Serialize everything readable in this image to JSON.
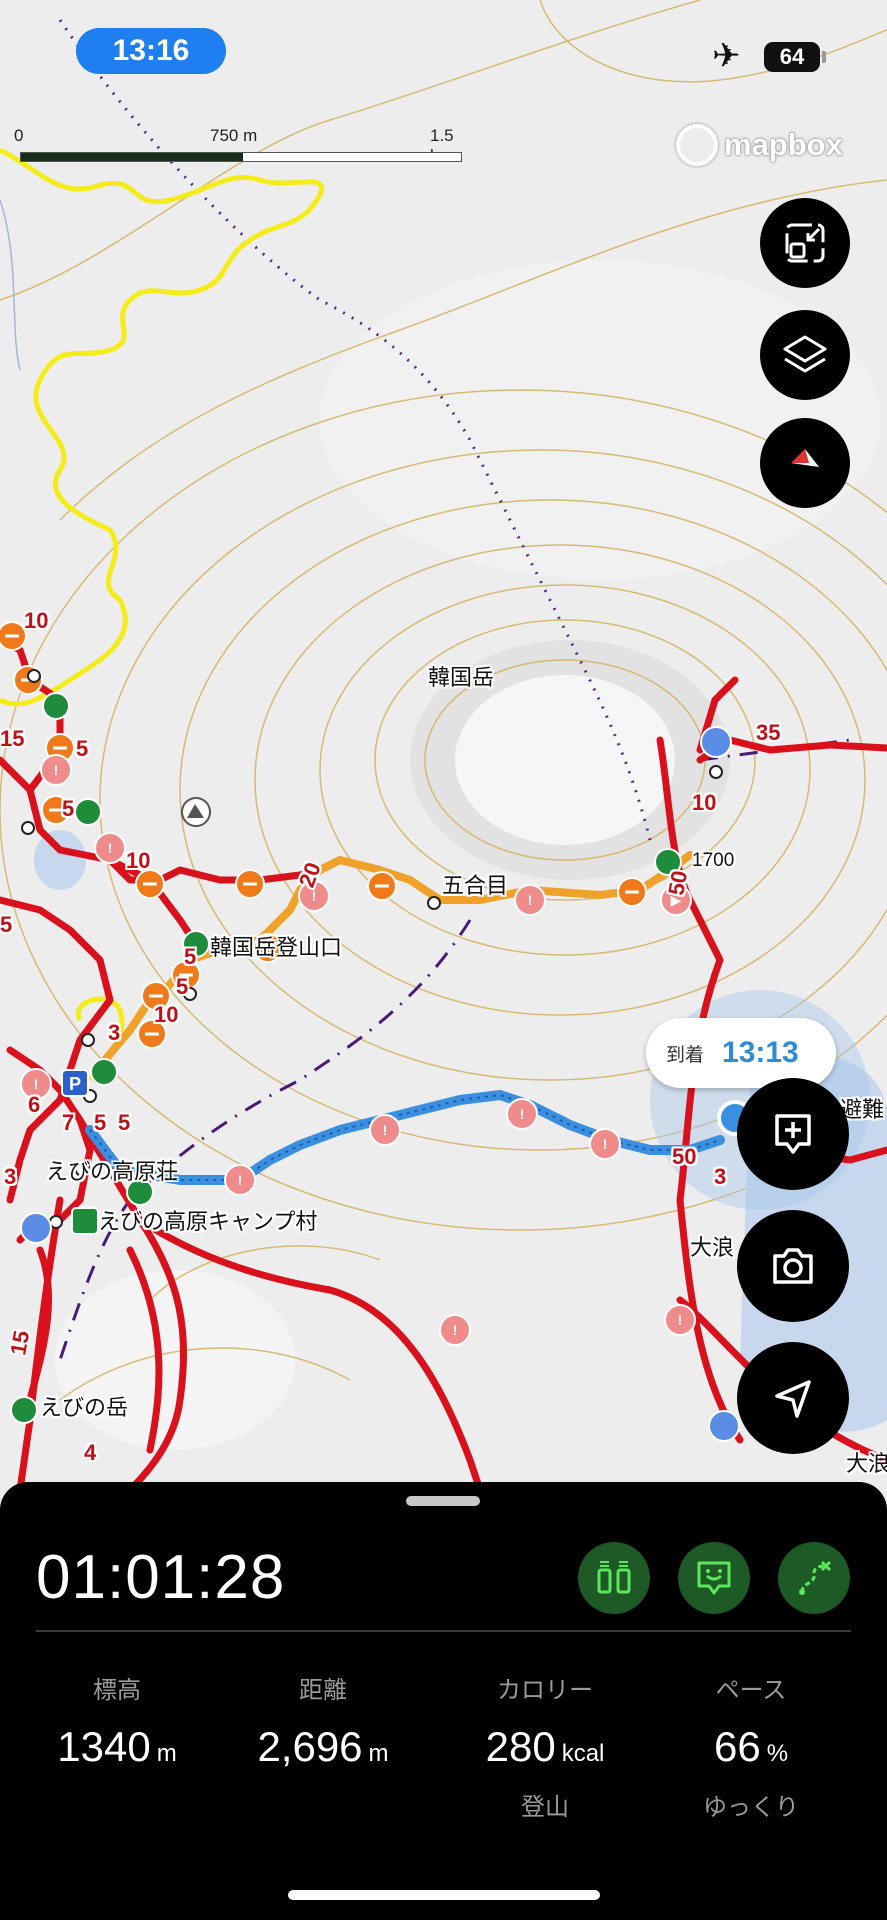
{
  "status_bar": {
    "time": "13:16",
    "battery": "64"
  },
  "scale_bar": {
    "labels": [
      "0",
      "750 m",
      "1.5 km"
    ]
  },
  "attribution": "mapbox",
  "map": {
    "labels": [
      "韓国岳",
      "五合目",
      "1700",
      "韓国岳登山口",
      "えびの高原荘",
      "えびの高原キャンプ村",
      "えびの岳",
      "避難",
      "大浪",
      "大浪"
    ],
    "route_numbers": [
      "10",
      "15",
      "5",
      "5",
      "10",
      "20",
      "5",
      "5",
      "10",
      "3",
      "6",
      "7",
      "5",
      "5",
      "3",
      "15",
      "4",
      "35",
      "10",
      "50",
      "50",
      "3",
      "5"
    ]
  },
  "eta": {
    "label": "到着",
    "time": "13:13"
  },
  "controls": {
    "zoom_fit": "zoom-fit",
    "layers": "layers",
    "compass": "compass",
    "add_note": "add-note",
    "camera": "camera",
    "locate": "locate"
  },
  "panel": {
    "timer": "01:01:28",
    "stats": [
      {
        "label": "標高",
        "value": "1340",
        "unit": "m",
        "sub": ""
      },
      {
        "label": "距離",
        "value": "2,696",
        "unit": "m",
        "sub": ""
      },
      {
        "label": "カロリー",
        "value": "280",
        "unit": "kcal",
        "sub": "登山"
      },
      {
        "label": "ペース",
        "value": "66",
        "unit": "%",
        "sub": "ゆっくり"
      }
    ]
  },
  "colors": {
    "route_red": "#d9111c",
    "route_orange": "#f0a12a",
    "route_blue": "#3a8fe0",
    "trail_yellow": "#f3ec1a",
    "status_blue": "#1f7ef0",
    "panel_bg": "#000000",
    "panel_btn": "#1d5a26",
    "panel_icon": "#5ce65c"
  }
}
